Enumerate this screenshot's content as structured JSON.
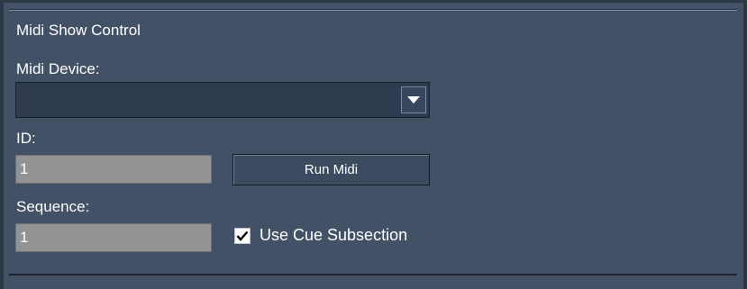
{
  "panel": {
    "title": "Midi Show Control"
  },
  "device": {
    "label": "Midi Device:",
    "value": "",
    "dropdown_icon": "triangle-down-icon"
  },
  "id_field": {
    "label": "ID:",
    "value": "1"
  },
  "run_button": {
    "label": "Run Midi"
  },
  "sequence_field": {
    "label": "Sequence:",
    "value": "1"
  },
  "cue_subsection": {
    "label": "Use Cue Subsection",
    "checked": true,
    "icon": "checkmark-icon"
  },
  "colors": {
    "panel_bg": "#435167",
    "textbox_bg": "#939393",
    "select_bg": "#2f3c4f"
  }
}
